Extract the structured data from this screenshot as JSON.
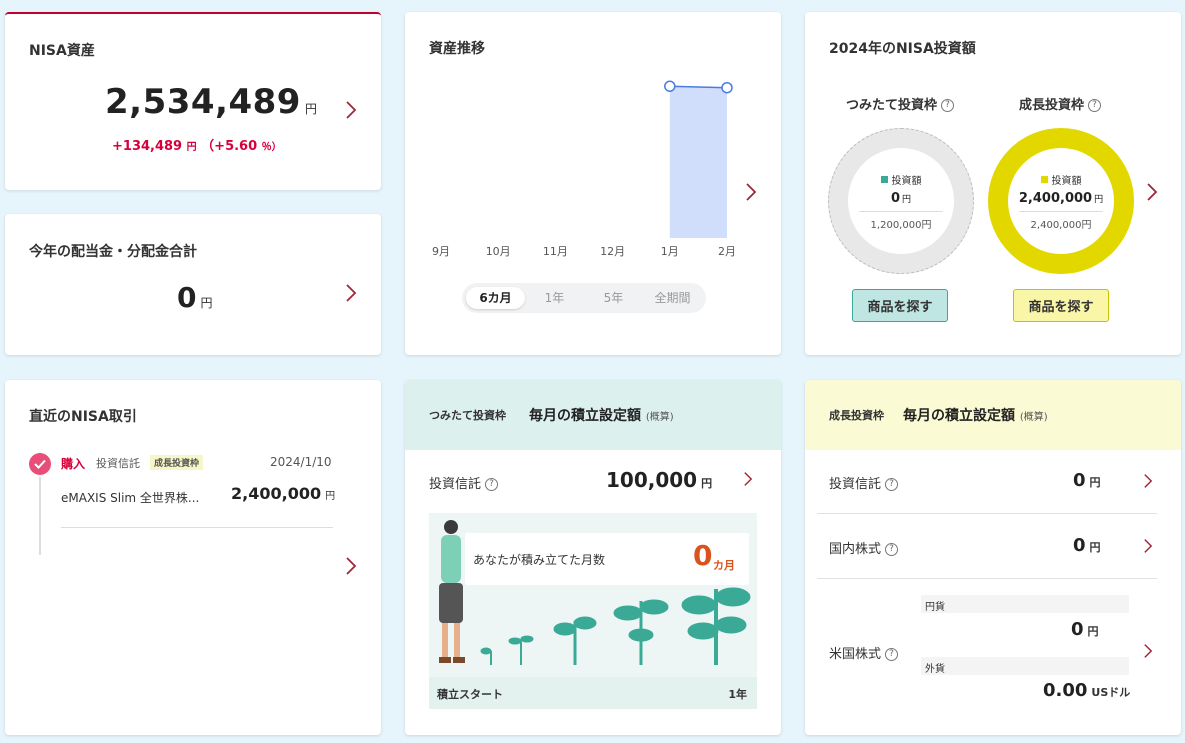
{
  "assets": {
    "title": "NISA資産",
    "value": "2,534,489",
    "unit": "円",
    "gain": "+134,489",
    "gain_unit": "円",
    "gain_pct_open": "（+5.60",
    "gain_pct_unit": "％）"
  },
  "dividends": {
    "title": "今年の配当金・分配金合計",
    "value": "0",
    "unit": "円"
  },
  "history": {
    "title": "資産推移",
    "chart_data": {
      "type": "area",
      "categories": [
        "9月",
        "10月",
        "11月",
        "12月",
        "1月",
        "2月"
      ],
      "values": [
        null,
        null,
        null,
        null,
        2560000,
        2534489
      ],
      "title": "資産推移",
      "xlabel": "",
      "ylabel": "",
      "ylim": [
        0,
        2800000
      ],
      "grid": false
    },
    "periods": [
      "6カ月",
      "1年",
      "5年",
      "全期間"
    ]
  },
  "invest": {
    "title": "2024年のNISA投資額",
    "tsumitate": {
      "label": "つみたて投資枠",
      "legend": "投資額",
      "amount": "0",
      "unit": "円",
      "limit": "1,200,000円",
      "button": "商品を探す"
    },
    "seicho": {
      "label": "成長投資枠",
      "legend": "投資額",
      "amount": "2,400,000",
      "unit": "円",
      "limit": "2,400,000円",
      "button": "商品を探す"
    },
    "colors": {
      "tsumitate": "#3aaa97",
      "seicho": "#e2d800",
      "empty": "#e8e8e8"
    }
  },
  "recent": {
    "title": "直近のNISA取引",
    "tx": {
      "type": "購入",
      "kind": "投資信託",
      "badge": "成長投資枠",
      "date": "2024/1/10",
      "name": "eMAXIS Slim 全世界株...",
      "amount": "2,400,000",
      "unit": "円"
    }
  },
  "monthly_tsumitate": {
    "frame": "つみたて投資枠",
    "title": "毎月の積立設定額",
    "note": "(概算)",
    "row": {
      "label": "投資信託",
      "value": "100,000",
      "unit": "円"
    },
    "months_label": "あなたが積み立てた月数",
    "months": "0",
    "months_unit": "カ月",
    "start": "積立スタート",
    "end": "1年"
  },
  "monthly_seicho": {
    "frame": "成長投資枠",
    "title": "毎月の積立設定額",
    "note": "(概算)",
    "rows": [
      {
        "label": "投資信託",
        "value": "0",
        "unit": "円"
      },
      {
        "label": "国内株式",
        "value": "0",
        "unit": "円"
      }
    ],
    "us": {
      "label": "米国株式",
      "yen_label": "円貨",
      "yen_value": "0",
      "yen_unit": "円",
      "fx_label": "外貨",
      "fx_value": "0.00",
      "fx_unit": "USドル"
    }
  }
}
